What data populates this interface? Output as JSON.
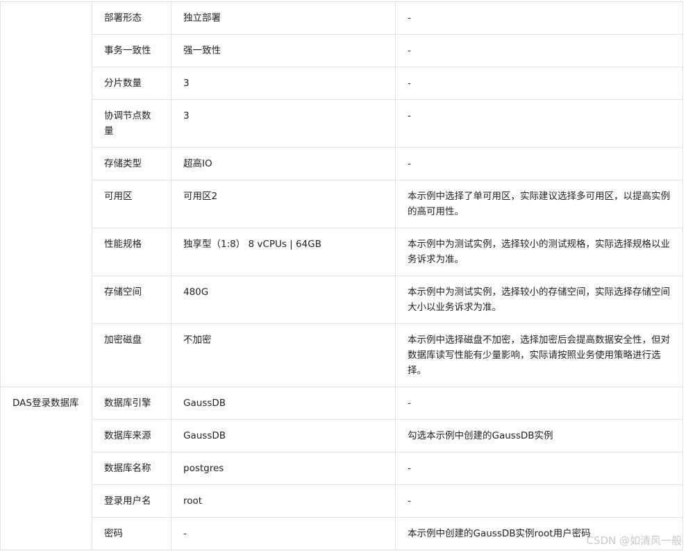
{
  "rows": [
    {
      "group": "",
      "param": "部署形态",
      "value": "独立部署",
      "note": "-"
    },
    {
      "group": "",
      "param": "事务一致性",
      "value": "强一致性",
      "note": "-"
    },
    {
      "group": "",
      "param": "分片数量",
      "value": "3",
      "note": "-"
    },
    {
      "group": "",
      "param": "协调节点数量",
      "value": "3",
      "note": "-"
    },
    {
      "group": "",
      "param": "存储类型",
      "value": "超高IO",
      "note": "-"
    },
    {
      "group": "",
      "param": "可用区",
      "value": "可用区2",
      "note": "本示例中选择了单可用区，实际建议选择多可用区，以提高实例的高可用性。"
    },
    {
      "group": "",
      "param": "性能规格",
      "value": "独享型（1:8） 8 vCPUs | 64GB",
      "note": "本示例中为测试实例，选择较小的测试规格，实际选择规格以业务诉求为准。"
    },
    {
      "group": "",
      "param": "存储空间",
      "value": "480G",
      "note": "本示例中为测试实例，选择较小的存储空间，实际选择存储空间大小以业务诉求为准。"
    },
    {
      "group": "",
      "param": "加密磁盘",
      "value": "不加密",
      "note": "本示例中选择磁盘不加密，选择加密后会提高数据安全性，但对数据库读写性能有少量影响，实际请按照业务使用策略进行选择。"
    },
    {
      "group": "DAS登录数据库",
      "param": "数据库引擎",
      "value": "GaussDB",
      "note": "-"
    },
    {
      "group": "",
      "param": "数据库来源",
      "value": "GaussDB",
      "note": "勾选本示例中创建的GaussDB实例"
    },
    {
      "group": "",
      "param": "数据库名称",
      "value": "postgres",
      "note": "-"
    },
    {
      "group": "",
      "param": "登录用户名",
      "value": "root",
      "note": "-"
    },
    {
      "group": "",
      "param": "密码",
      "value": "-",
      "note": "本示例中创建的GaussDB实例root用户密码"
    }
  ],
  "watermark": "CSDN @如清风一般"
}
